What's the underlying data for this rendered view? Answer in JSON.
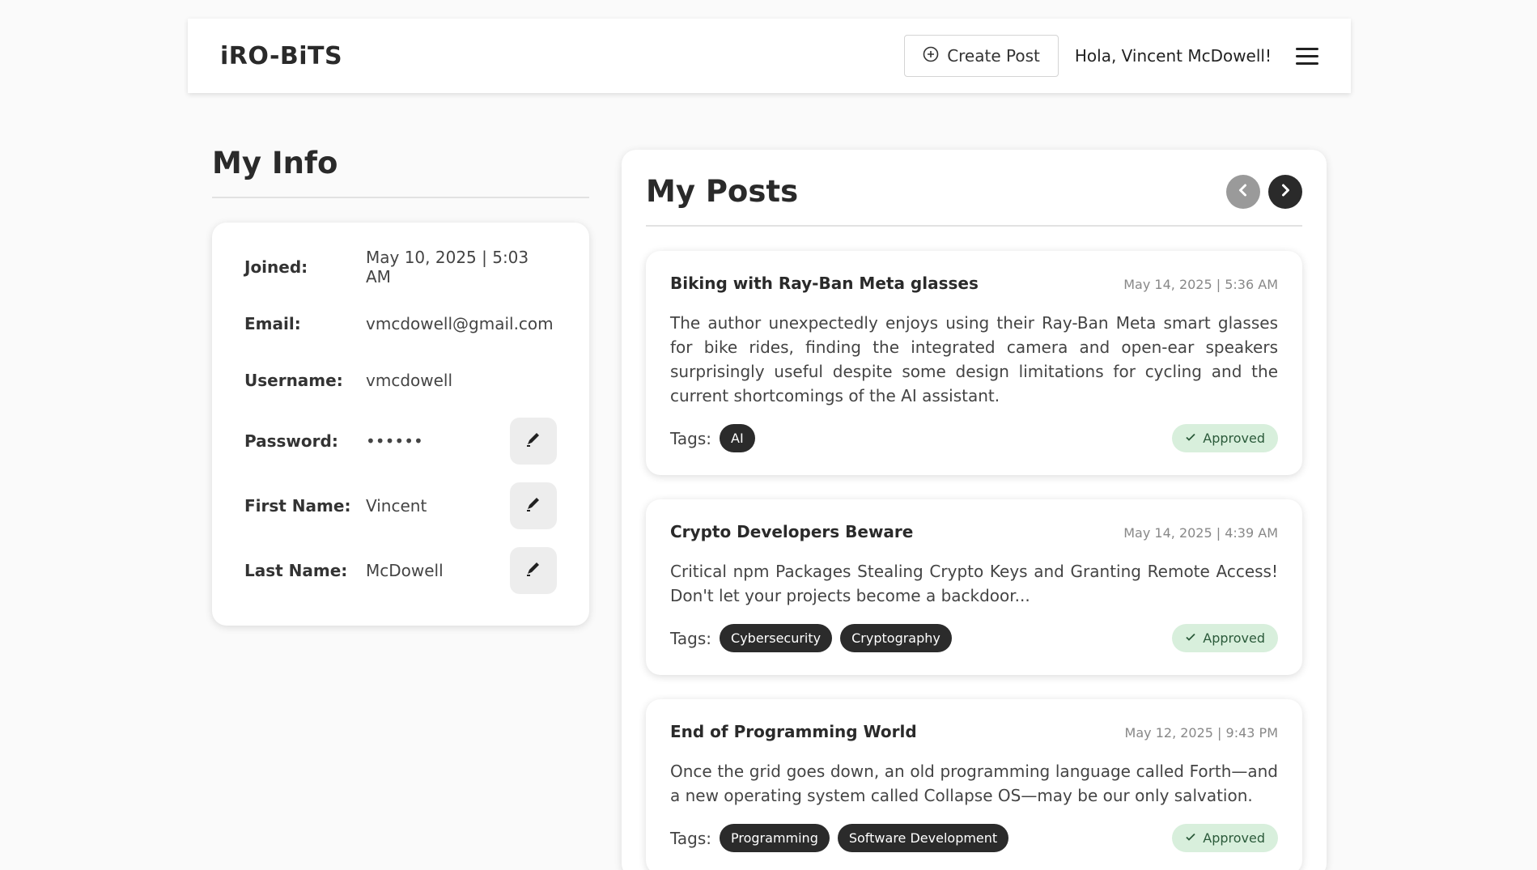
{
  "header": {
    "brand": "iRO-BiTS",
    "create_label": "Create Post",
    "greeting": "Hola, Vincent McDowell!"
  },
  "info": {
    "title": "My Info",
    "rows": [
      {
        "label": "Joined:",
        "value": "May 10, 2025 | 5:03 AM"
      },
      {
        "label": "Email:",
        "value": "vmcdowell@gmail.com"
      },
      {
        "label": "Username:",
        "value": "vmcdowell"
      },
      {
        "label": "Password:",
        "value": "••••••"
      },
      {
        "label": "First Name:",
        "value": "Vincent"
      },
      {
        "label": "Last Name:",
        "value": "McDowell"
      }
    ]
  },
  "posts": {
    "title": "My Posts",
    "tags_label": "Tags:",
    "items": [
      {
        "title": "Biking with Ray-Ban Meta glasses",
        "date": "May 14, 2025 | 5:36 AM",
        "body": "The author unexpectedly enjoys using their Ray-Ban Meta smart glasses for bike rides, finding the integrated camera and open-ear speakers surprisingly useful despite some design limitations for cycling and the current shortcomings of the AI assistant.",
        "tags": [
          "AI"
        ],
        "status": "Approved"
      },
      {
        "title": "Crypto Developers Beware",
        "date": "May 14, 2025 | 4:39 AM",
        "body": "Critical npm Packages Stealing Crypto Keys and Granting Remote Access! Don't let your projects become a backdoor...",
        "tags": [
          "Cybersecurity",
          "Cryptography"
        ],
        "status": "Approved"
      },
      {
        "title": "End of Programming World",
        "date": "May 12, 2025 | 9:43 PM",
        "body": "Once the grid goes down, an old programming language called Forth—and a new operating system called Collapse OS—may be our only salvation.",
        "tags": [
          "Programming",
          "Software Development"
        ],
        "status": "Approved"
      }
    ]
  }
}
